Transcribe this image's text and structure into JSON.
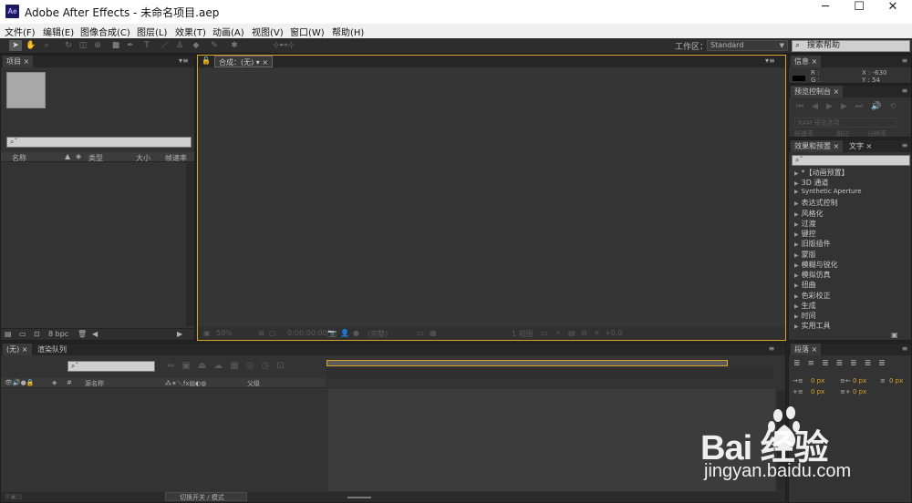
{
  "window": {
    "app_icon": "Ae",
    "title": "Adobe After Effects - 未命名项目.aep",
    "minimize": "─",
    "maximize": "☐",
    "close": "✕"
  },
  "menu": [
    "文件(F)",
    "编辑(E)",
    "图像合成(C)",
    "图层(L)",
    "效果(T)",
    "动画(A)",
    "视图(V)",
    "窗口(W)",
    "帮助(H)"
  ],
  "toolbar": {
    "workspace_label": "工作区：",
    "workspace_value": "Standard",
    "search_help_placeholder": "搜索帮助"
  },
  "project_panel": {
    "tab": "项目",
    "columns": [
      "名称",
      "类型",
      "大小",
      "帧速率"
    ],
    "bpc": "8 bpc"
  },
  "comp_panel": {
    "tab": "合成：(无)",
    "zoom": "50%",
    "timecode": "0:00:00:00",
    "resolution": "(完整)",
    "view": "1 视图",
    "exposure": "+0.0"
  },
  "info_panel": {
    "tab": "信息",
    "r_label": "R :",
    "g_label": "G :",
    "x_value": "X : -630",
    "y_value": "Y : 54"
  },
  "preview_panel": {
    "tab": "预览控制台",
    "ram_label": "RAM 预览选项",
    "frame_rate": "帧速率",
    "skip": "跳过",
    "resolution": "分辨率"
  },
  "effects_panel": {
    "tabs": [
      "效果和预置",
      "文字"
    ],
    "items": [
      "*【动画预置】",
      "3D 通道",
      "Synthetic Aperture",
      "表达式控制",
      "风格化",
      "过渡",
      "键控",
      "旧版插件",
      "蒙版",
      "模糊与锐化",
      "模拟仿真",
      "扭曲",
      "色彩校正",
      "生成",
      "时间",
      "实用工具"
    ]
  },
  "timeline_panel": {
    "tabs": [
      "(无)",
      "渲染队列"
    ],
    "source_name": "源名称",
    "parent": "父级",
    "switch_modes": "切换开关 / 模式"
  },
  "paragraph_panel": {
    "tab": "段落",
    "indent_values": [
      "0 px",
      "0 px",
      "0 px",
      "0 px",
      "0 px"
    ]
  },
  "watermark": {
    "logo_text": "Bai 经验",
    "url": "jingyan.baidu.com"
  },
  "colors": {
    "accent": "#d8a328",
    "panel_bg": "#333333",
    "app_bg": "#232323"
  }
}
